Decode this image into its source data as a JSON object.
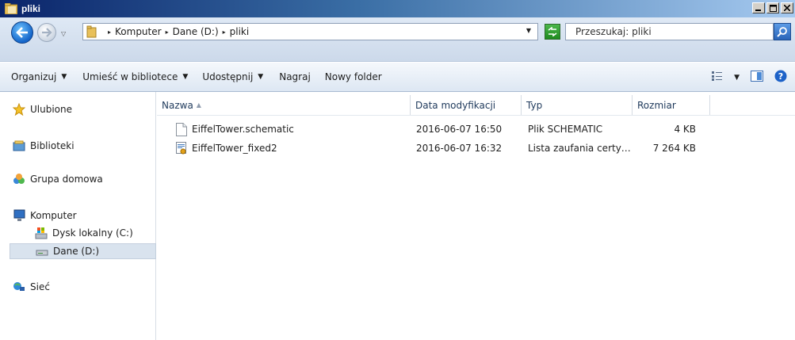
{
  "window": {
    "title": "pliki"
  },
  "address": {
    "crumbs": [
      "Komputer",
      "Dane (D:)",
      "pliki"
    ],
    "separator": "▸"
  },
  "search": {
    "placeholder": "Przeszukaj: pliki"
  },
  "toolbar": {
    "organize": "Organizuj",
    "include_library": "Umieść w bibliotece",
    "share": "Udostępnij",
    "burn": "Nagraj",
    "new_folder": "Nowy folder"
  },
  "nav": {
    "favorites": "Ulubione",
    "libraries": "Biblioteki",
    "homegroup": "Grupa domowa",
    "computer": "Komputer",
    "drive_c": "Dysk lokalny (C:)",
    "drive_d": "Dane (D:)",
    "network": "Sieć"
  },
  "columns": {
    "name": "Nazwa",
    "modified": "Data modyfikacji",
    "type": "Typ",
    "size": "Rozmiar"
  },
  "files": [
    {
      "name": "EiffelTower.schematic",
      "modified": "2016-06-07 16:50",
      "type": "Plik SCHEMATIC",
      "size": "4 KB",
      "icon": "blank-file-icon"
    },
    {
      "name": "EiffelTower_fixed2",
      "modified": "2016-06-07 16:32",
      "type": "Lista zaufania certy…",
      "size": "7 264 KB",
      "icon": "certificate-file-icon"
    }
  ],
  "colors": {
    "accent": "#1e395b",
    "selection": "#d9e3ee"
  }
}
